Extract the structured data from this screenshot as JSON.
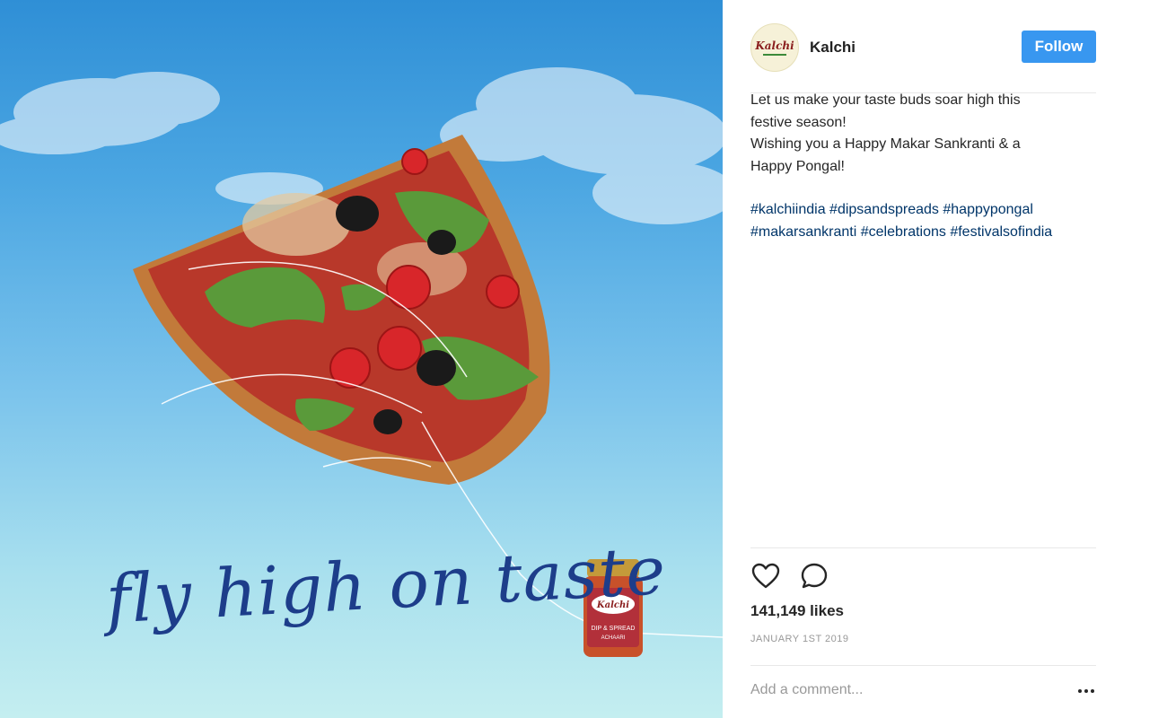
{
  "post": {
    "username": "Kalchi",
    "avatar_text": "Kalchi",
    "follow_label": "Follow",
    "image": {
      "tagline": "fly high on taste",
      "jar_brand": "Kalchi",
      "jar_line1": "DIP & SPREAD",
      "jar_line2": "ACHAARI"
    },
    "caption": {
      "lines": [
        "Let us make your taste buds soar high this",
        "festive season!",
        "Wishing you a Happy Makar Sankranti & a",
        "Happy Pongal!"
      ],
      "hashtag_lines": [
        "#kalchiindia #dipsandspreads #happypongal",
        "#makarsankranti #celebrations #festivalsofindia"
      ]
    },
    "actions": {
      "like_icon": "heart-icon",
      "comment_icon": "comment-icon"
    },
    "likes": "141,149 likes",
    "date": "JANUARY 1ST 2019",
    "comment_placeholder": "Add a comment...",
    "more_icon": "more-options-icon"
  },
  "colors": {
    "follow_button": "#3897f0",
    "hashtag": "#003569",
    "tagline": "#1d3d8a"
  }
}
